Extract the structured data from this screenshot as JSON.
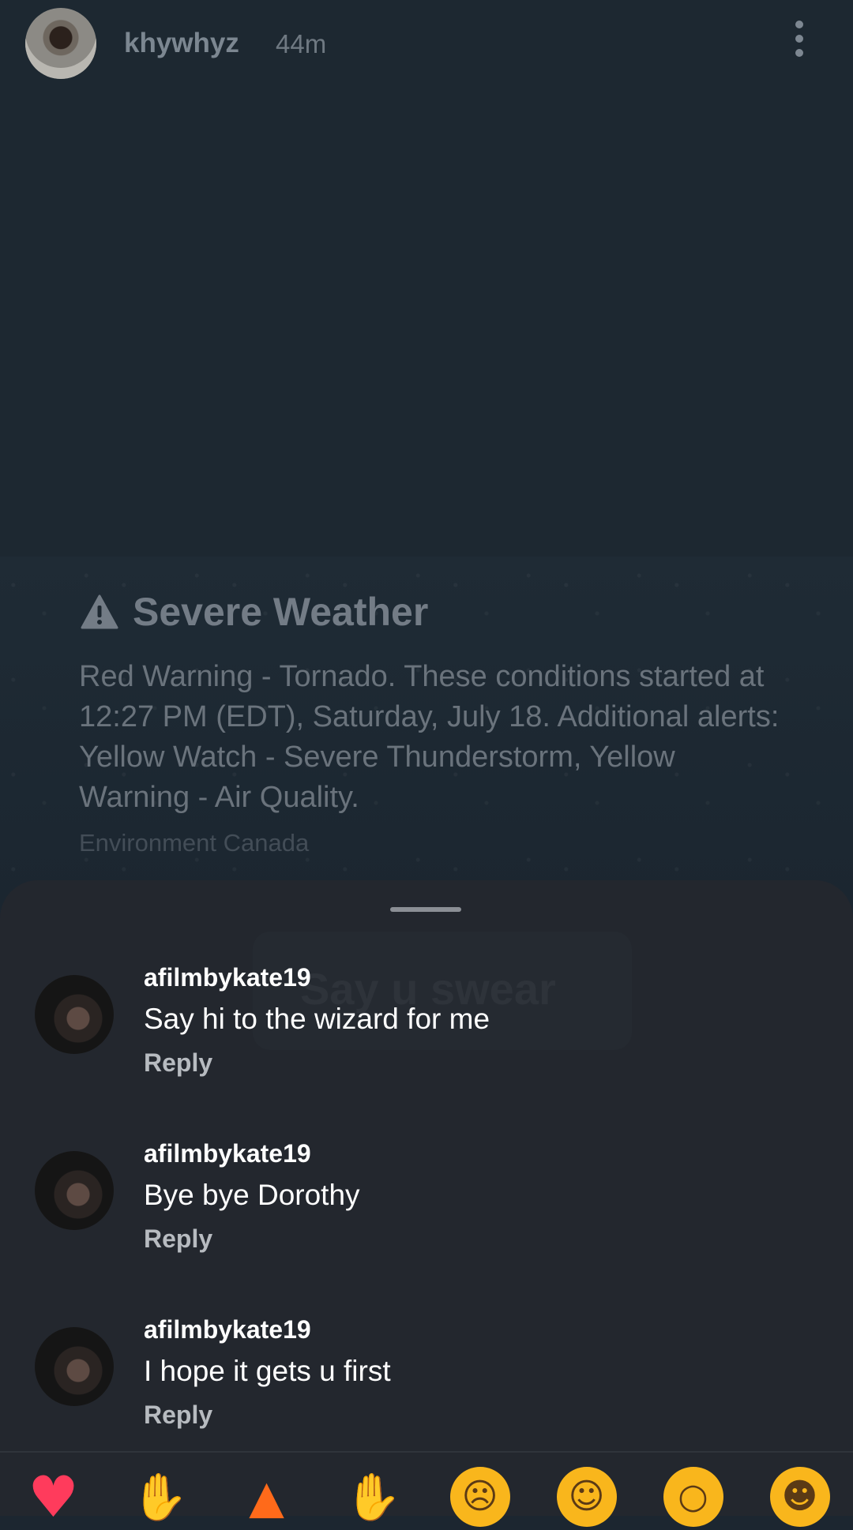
{
  "header": {
    "username": "khywhyz",
    "time": "44m"
  },
  "alert": {
    "title": "Severe Weather",
    "body": "Red Warning - Tornado. These conditions started at 12:27 PM (EDT), Saturday, July 18. Additional alerts: Yellow Watch - Severe Thunderstorm, Yellow Warning - Air Quality.",
    "source": "Environment Canada"
  },
  "ghost_text": "Say u swear",
  "comments": [
    {
      "user": "afilmbykate19",
      "text": "Say hi to the wizard for me",
      "reply": "Reply"
    },
    {
      "user": "afilmbykate19",
      "text": "Bye bye Dorothy",
      "reply": "Reply"
    },
    {
      "user": "afilmbykate19",
      "text": "I hope it gets u first",
      "reply": "Reply"
    }
  ],
  "emojis": [
    "heart-emoji",
    "raising-hands-emoji",
    "fire-emoji",
    "clapping-hands-emoji",
    "crying-face-emoji",
    "heart-eyes-emoji",
    "surprised-face-emoji",
    "tears-of-joy-emoji"
  ]
}
